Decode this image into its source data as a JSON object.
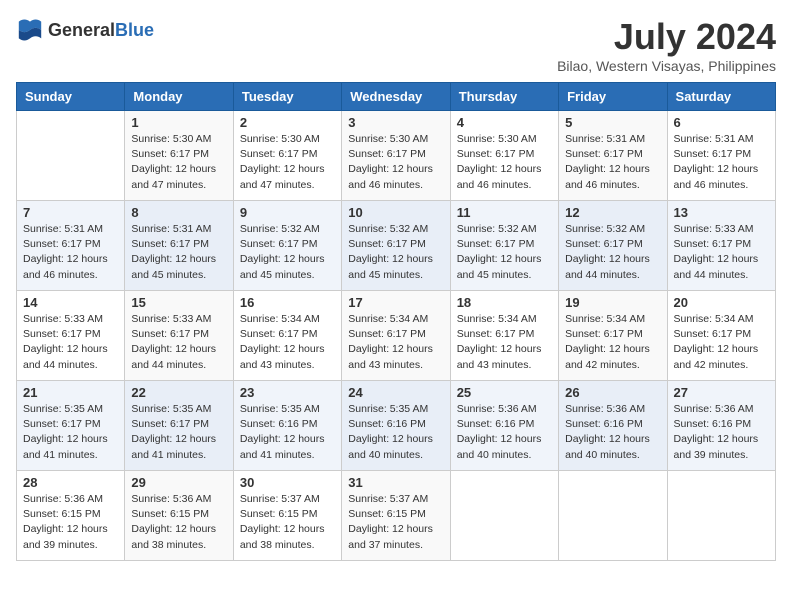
{
  "logo": {
    "general": "General",
    "blue": "Blue"
  },
  "title": "July 2024",
  "location": "Bilao, Western Visayas, Philippines",
  "headers": [
    "Sunday",
    "Monday",
    "Tuesday",
    "Wednesday",
    "Thursday",
    "Friday",
    "Saturday"
  ],
  "weeks": [
    [
      {
        "day": "",
        "info": ""
      },
      {
        "day": "1",
        "info": "Sunrise: 5:30 AM\nSunset: 6:17 PM\nDaylight: 12 hours\nand 47 minutes."
      },
      {
        "day": "2",
        "info": "Sunrise: 5:30 AM\nSunset: 6:17 PM\nDaylight: 12 hours\nand 47 minutes."
      },
      {
        "day": "3",
        "info": "Sunrise: 5:30 AM\nSunset: 6:17 PM\nDaylight: 12 hours\nand 46 minutes."
      },
      {
        "day": "4",
        "info": "Sunrise: 5:30 AM\nSunset: 6:17 PM\nDaylight: 12 hours\nand 46 minutes."
      },
      {
        "day": "5",
        "info": "Sunrise: 5:31 AM\nSunset: 6:17 PM\nDaylight: 12 hours\nand 46 minutes."
      },
      {
        "day": "6",
        "info": "Sunrise: 5:31 AM\nSunset: 6:17 PM\nDaylight: 12 hours\nand 46 minutes."
      }
    ],
    [
      {
        "day": "7",
        "info": ""
      },
      {
        "day": "8",
        "info": "Sunrise: 5:31 AM\nSunset: 6:17 PM\nDaylight: 12 hours\nand 45 minutes."
      },
      {
        "day": "9",
        "info": "Sunrise: 5:32 AM\nSunset: 6:17 PM\nDaylight: 12 hours\nand 45 minutes."
      },
      {
        "day": "10",
        "info": "Sunrise: 5:32 AM\nSunset: 6:17 PM\nDaylight: 12 hours\nand 45 minutes."
      },
      {
        "day": "11",
        "info": "Sunrise: 5:32 AM\nSunset: 6:17 PM\nDaylight: 12 hours\nand 45 minutes."
      },
      {
        "day": "12",
        "info": "Sunrise: 5:32 AM\nSunset: 6:17 PM\nDaylight: 12 hours\nand 44 minutes."
      },
      {
        "day": "13",
        "info": "Sunrise: 5:33 AM\nSunset: 6:17 PM\nDaylight: 12 hours\nand 44 minutes."
      }
    ],
    [
      {
        "day": "14",
        "info": ""
      },
      {
        "day": "15",
        "info": "Sunrise: 5:33 AM\nSunset: 6:17 PM\nDaylight: 12 hours\nand 44 minutes."
      },
      {
        "day": "16",
        "info": "Sunrise: 5:34 AM\nSunset: 6:17 PM\nDaylight: 12 hours\nand 43 minutes."
      },
      {
        "day": "17",
        "info": "Sunrise: 5:34 AM\nSunset: 6:17 PM\nDaylight: 12 hours\nand 43 minutes."
      },
      {
        "day": "18",
        "info": "Sunrise: 5:34 AM\nSunset: 6:17 PM\nDaylight: 12 hours\nand 43 minutes."
      },
      {
        "day": "19",
        "info": "Sunrise: 5:34 AM\nSunset: 6:17 PM\nDaylight: 12 hours\nand 42 minutes."
      },
      {
        "day": "20",
        "info": "Sunrise: 5:34 AM\nSunset: 6:17 PM\nDaylight: 12 hours\nand 42 minutes."
      }
    ],
    [
      {
        "day": "21",
        "info": ""
      },
      {
        "day": "22",
        "info": "Sunrise: 5:35 AM\nSunset: 6:17 PM\nDaylight: 12 hours\nand 41 minutes."
      },
      {
        "day": "23",
        "info": "Sunrise: 5:35 AM\nSunset: 6:16 PM\nDaylight: 12 hours\nand 41 minutes."
      },
      {
        "day": "24",
        "info": "Sunrise: 5:35 AM\nSunset: 6:16 PM\nDaylight: 12 hours\nand 40 minutes."
      },
      {
        "day": "25",
        "info": "Sunrise: 5:36 AM\nSunset: 6:16 PM\nDaylight: 12 hours\nand 40 minutes."
      },
      {
        "day": "26",
        "info": "Sunrise: 5:36 AM\nSunset: 6:16 PM\nDaylight: 12 hours\nand 40 minutes."
      },
      {
        "day": "27",
        "info": "Sunrise: 5:36 AM\nSunset: 6:16 PM\nDaylight: 12 hours\nand 39 minutes."
      }
    ],
    [
      {
        "day": "28",
        "info": "Sunrise: 5:36 AM\nSunset: 6:15 PM\nDaylight: 12 hours\nand 39 minutes."
      },
      {
        "day": "29",
        "info": "Sunrise: 5:36 AM\nSunset: 6:15 PM\nDaylight: 12 hours\nand 38 minutes."
      },
      {
        "day": "30",
        "info": "Sunrise: 5:37 AM\nSunset: 6:15 PM\nDaylight: 12 hours\nand 38 minutes."
      },
      {
        "day": "31",
        "info": "Sunrise: 5:37 AM\nSunset: 6:15 PM\nDaylight: 12 hours\nand 37 minutes."
      },
      {
        "day": "",
        "info": ""
      },
      {
        "day": "",
        "info": ""
      },
      {
        "day": "",
        "info": ""
      }
    ]
  ],
  "week7_sunday": "Sunrise: 5:31 AM\nSunset: 6:17 PM\nDaylight: 12 hours\nand 46 minutes.",
  "week14_sunday": "Sunrise: 5:33 AM\nSunset: 6:17 PM\nDaylight: 12 hours\nand 44 minutes.",
  "week21_sunday": "Sunrise: 5:35 AM\nSunset: 6:17 PM\nDaylight: 12 hours\nand 41 minutes."
}
